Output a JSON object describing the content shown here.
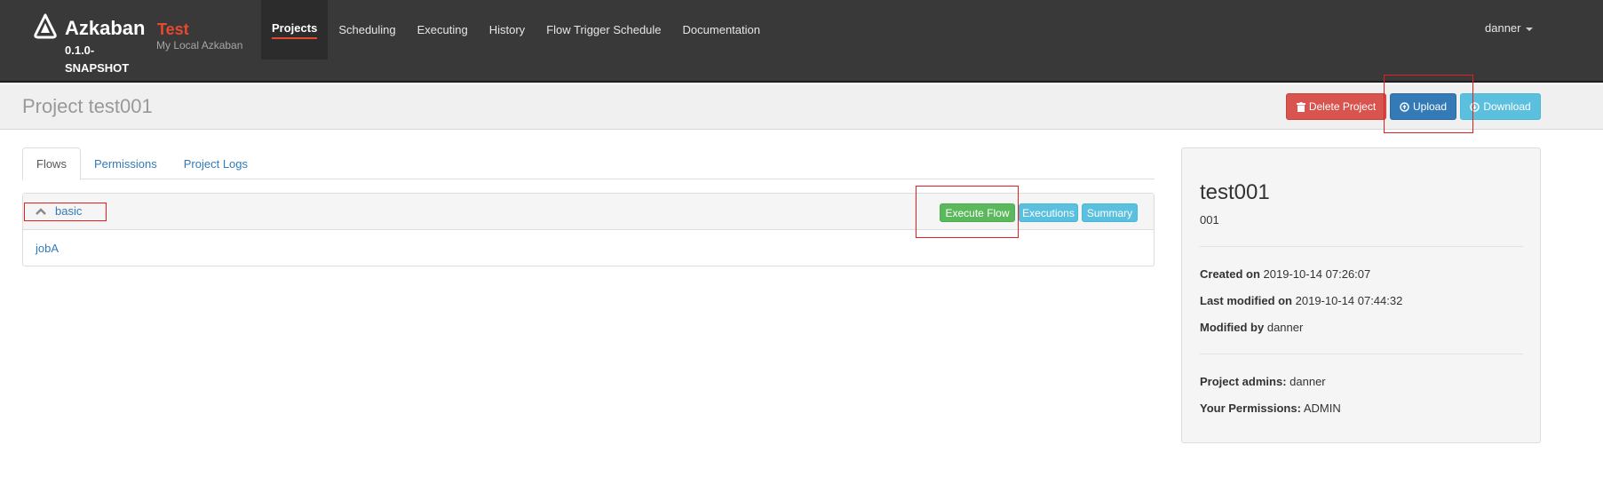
{
  "navbar": {
    "brand_name": "Azkaban",
    "version": "0.1.0-SNAPSHOT",
    "env_name": "Test",
    "env_desc": "My Local Azkaban",
    "items": [
      {
        "label": "Projects"
      },
      {
        "label": "Scheduling"
      },
      {
        "label": "Executing"
      },
      {
        "label": "History"
      },
      {
        "label": "Flow Trigger Schedule"
      },
      {
        "label": "Documentation"
      }
    ],
    "user": "danner"
  },
  "header": {
    "title": "Project test001",
    "delete_label": "Delete Project",
    "upload_label": "Upload",
    "download_label": "Download"
  },
  "tabs": [
    {
      "label": "Flows"
    },
    {
      "label": "Permissions"
    },
    {
      "label": "Project Logs"
    }
  ],
  "flow": {
    "name": "basic",
    "execute_label": "Execute Flow",
    "executions_label": "Executions",
    "summary_label": "Summary",
    "jobs": [
      "jobA"
    ]
  },
  "project_info": {
    "name": "test001",
    "description": "001",
    "created_label": "Created on",
    "created_value": "2019-10-14 07:26:07",
    "modified_label": "Last modified on",
    "modified_value": "2019-10-14 07:44:32",
    "modified_by_label": "Modified by",
    "modified_by_value": "danner",
    "admins_label": "Project admins:",
    "admins_value": "danner",
    "permissions_label": "Your Permissions:",
    "permissions_value": "ADMIN"
  },
  "colors": {
    "navbar": "#393939",
    "accent": "#e8482e",
    "danger": "#d9534f",
    "primary": "#337ab7",
    "info": "#5bc0de",
    "success": "#5cb85c",
    "annotation": "#e81e1e"
  }
}
